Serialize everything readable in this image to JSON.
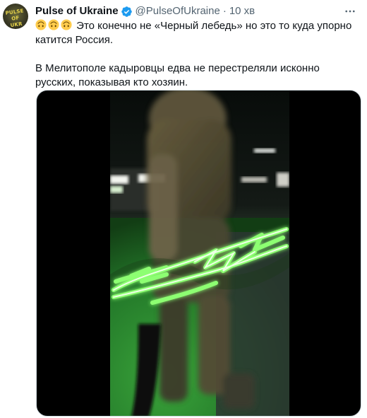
{
  "tweet": {
    "author_name": "Pulse of Ukraine",
    "handle": "@PulseOfUkraine",
    "separator": "·",
    "time": "10 хв",
    "avatar_text": [
      "PULSE",
      "OF",
      "UKR"
    ],
    "text_line1": "Это конечно не «Черный лебедь» но это то куда упорно катится Россия.",
    "text_line2": "В Мелитополе кадыровцы едва не перестреляли исконно русских, показывая кто хозяин.",
    "emojis": [
      "upside-down-face",
      "upside-down-face",
      "upside-down-face"
    ]
  },
  "icons": {
    "verified": "verified-badge-icon",
    "more": "more-dots-icon"
  },
  "colors": {
    "verified_blue": "#1d9bf0",
    "secondary_text": "#536471",
    "primary_text": "#0f1419",
    "neon_green": "#6dff5c"
  }
}
